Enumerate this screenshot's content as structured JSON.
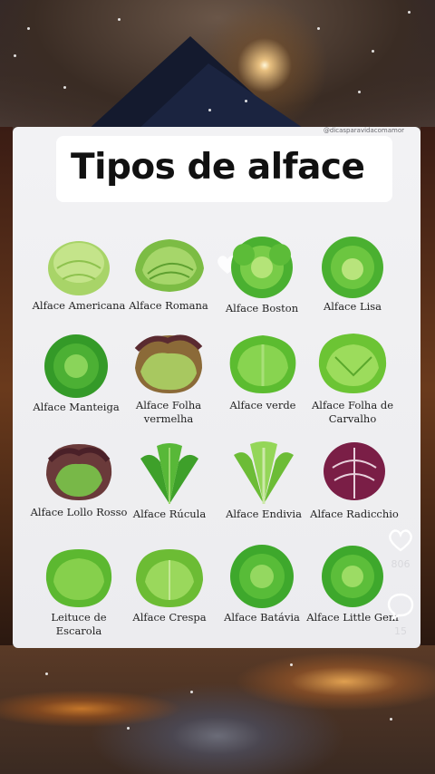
{
  "post": {
    "watermark": "@dicasparavidacomamor",
    "title": "Tipos de alface",
    "items": [
      {
        "label": "Alface Americana",
        "icon": "iceberg-lettuce-icon",
        "color": "#b9de7a"
      },
      {
        "label": "Alface Romana",
        "icon": "romaine-lettuce-icon",
        "color": "#8fc650"
      },
      {
        "label": "Alface Boston",
        "icon": "boston-lettuce-icon",
        "color": "#5cb838"
      },
      {
        "label": "Alface Lisa",
        "icon": "butterhead-lettuce-icon",
        "color": "#5cb838"
      },
      {
        "label": "Alface Manteiga",
        "icon": "butter-lettuce-icon",
        "color": "#3f9e2c"
      },
      {
        "label": "Alface Folha vermelha",
        "icon": "red-leaf-lettuce-icon",
        "color": "#8a5a30"
      },
      {
        "label": "Alface verde",
        "icon": "green-leaf-lettuce-icon",
        "color": "#6cc43a"
      },
      {
        "label": "Alface Folha de Carvalho",
        "icon": "oak-leaf-lettuce-icon",
        "color": "#7ccf3e"
      },
      {
        "label": "Alface Lollo Rosso",
        "icon": "lollo-rosso-lettuce-icon",
        "color": "#6e3a3a"
      },
      {
        "label": "Alface Rúcula",
        "icon": "arugula-icon",
        "color": "#4aa830"
      },
      {
        "label": "Alface Endivia",
        "icon": "endive-icon",
        "color": "#86cc40"
      },
      {
        "label": "Alface Radicchio",
        "icon": "radicchio-icon",
        "color": "#8a2850"
      },
      {
        "label": "Leituce de Escarola",
        "icon": "escarole-icon",
        "color": "#6cc43a"
      },
      {
        "label": "Alface Crespa",
        "icon": "curly-lettuce-icon",
        "color": "#78c640"
      },
      {
        "label": "Alface Batávia",
        "icon": "batavia-lettuce-icon",
        "color": "#4cb030"
      },
      {
        "label": "Alface Little Gem",
        "icon": "little-gem-lettuce-icon",
        "color": "#4cb030"
      }
    ]
  },
  "actions": {
    "like_count": "806",
    "comment_count": "15"
  }
}
